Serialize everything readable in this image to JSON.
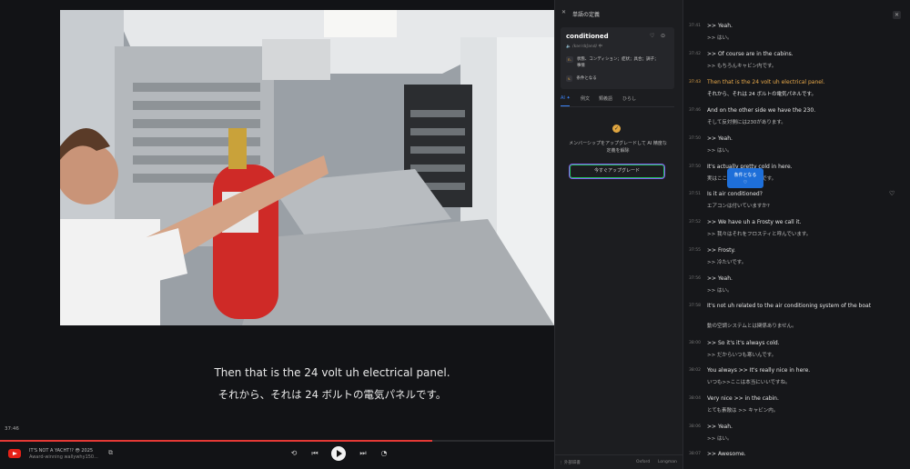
{
  "video": {
    "subtitle_en": "Then that is the 24 volt uh electrical panel.",
    "subtitle_ja": "それから、それは 24 ボルトの電気パネルです。",
    "current_time": "37:46",
    "progress_fraction": 0.78
  },
  "player": {
    "channel_title": "IT'S NOT A YACHT!? 😳 2025",
    "channel_subtitle": "Award-winning wallywhy150...",
    "icons": {
      "external": "external-link-icon",
      "loop": "loop-icon",
      "prev": "previous-icon",
      "play": "play-icon",
      "next": "next-icon",
      "speed": "speed-icon"
    }
  },
  "dictionary": {
    "header": "単語の定義",
    "word": "conditioned",
    "pronunciation": "/kənˈdɪʃənd/ 中",
    "definitions": [
      {
        "pos": "n.",
        "text": "状態、コンディション；症状；具合；調子；事情"
      },
      {
        "pos": "v.",
        "text": "条件となる"
      }
    ],
    "tabs": [
      "AI ✦",
      "例文",
      "類義語",
      "ひらし"
    ],
    "upgrade_message": "メンバーシップをアップグレードして AI 精度な定義を解除",
    "upgrade_button": "今すぐアップグレード",
    "footer": [
      "⋮ 外部辞書",
      "Oxford",
      "Longman"
    ],
    "accent": "#3b82f6"
  },
  "transcript": {
    "lines": [
      {
        "time": "37:41",
        "en": ">> Yeah.",
        "ja": ">> はい。"
      },
      {
        "time": "37:42",
        "en": ">> Of course are in the cabins.",
        "ja": ">> もちろんキャビン内です。"
      },
      {
        "time": "37:43",
        "en": "Then that is the 24 volt uh electrical panel.",
        "ja": "それから、それは 24 ボルトの電気パネルです。",
        "active": true
      },
      {
        "time": "37:46",
        "en": "And on the other side we have the 230.",
        "ja": "そして反対側には230があります。"
      },
      {
        "time": "37:50",
        "en": ">> Yeah.",
        "ja": ">> はい。"
      },
      {
        "time": "37:50",
        "en": "It's actually pretty cold in here.",
        "ja": "実はここはかなり寒いんです。"
      },
      {
        "time": "37:51",
        "en": "Is it air conditioned?",
        "ja": "エアコンは付いていますか?"
      },
      {
        "time": "37:52",
        "en": ">> We have uh a Frosty we call it.",
        "ja": ">> 我々はそれをフロスティと呼んでいます。"
      },
      {
        "time": "37:55",
        "en": ">> Frosty.",
        "ja": ">> 冷たいです。"
      },
      {
        "time": "37:56",
        "en": ">> Yeah.",
        "ja": ">> はい。"
      },
      {
        "time": "37:58",
        "en": "It's not uh related to the air conditioning system of the boat",
        "ja": "動の空調システムとは関係ありません。"
      },
      {
        "time": "38:00",
        "en": ">> So it's it's always cold.",
        "ja": ">> だからいつも寒いんです。"
      },
      {
        "time": "38:02",
        "en": "You always >> It's really nice in here.",
        "ja": "いつも>>ここは本当にいいですね。"
      },
      {
        "time": "38:04",
        "en": "Very nice >> in the cabin.",
        "ja": "とても素敵は >> キャビン内。"
      },
      {
        "time": "38:06",
        "en": ">> Yeah.",
        "ja": ">> はい。"
      },
      {
        "time": "38:07",
        "en": ">> Awesome.",
        "ja": ""
      }
    ],
    "tooltip_label": "条件となる",
    "tooltip_icon": "heart-icon",
    "highlight_color": "#e8a94a"
  }
}
